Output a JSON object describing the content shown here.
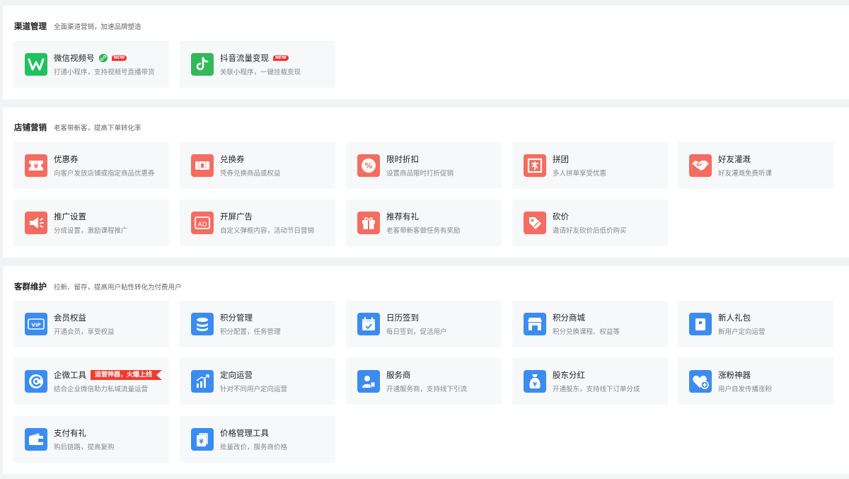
{
  "sections": [
    {
      "title": "渠道管理",
      "subtitle": "全面渠道营销，加速品牌塑造",
      "cards": [
        {
          "title": "微信视频号",
          "desc": "打通小程序，支持视频号直播带货",
          "badge": "NEW",
          "icon": "wechat-channels-icon"
        },
        {
          "title": "抖音流量变现",
          "desc": "关联小程序，一键挂载变现",
          "badge": "NEW",
          "icon": "douyin-icon"
        }
      ]
    },
    {
      "title": "店铺营销",
      "subtitle": "老客带新客，提高下单转化率",
      "cards": [
        {
          "title": "优惠券",
          "desc": "向客户发放店铺或指定商品优惠券",
          "icon": "coupon-icon"
        },
        {
          "title": "兑换券",
          "desc": "凭券兑换商品或权益",
          "icon": "voucher-icon"
        },
        {
          "title": "限时折扣",
          "desc": "设置商品限时打折促销",
          "icon": "discount-icon"
        },
        {
          "title": "拼团",
          "desc": "多人拼单享受优惠",
          "icon": "group-buy-icon"
        },
        {
          "title": "好友灌溉",
          "desc": "好友灌溉免费听课",
          "icon": "handshake-icon"
        },
        {
          "title": "推广设置",
          "desc": "分成设置，激励课程推广",
          "icon": "megaphone-icon"
        },
        {
          "title": "开屏广告",
          "desc": "自定义弹框内容，活动节日营销",
          "icon": "ad-icon"
        },
        {
          "title": "推荐有礼",
          "desc": "老客带新客做任务有奖励",
          "icon": "gift-icon"
        },
        {
          "title": "砍价",
          "desc": "邀请好友砍价后低价购买",
          "icon": "bargain-icon"
        }
      ]
    },
    {
      "title": "客群维护",
      "subtitle": "拉新、留存，提高用户粘性转化为付费用户",
      "cards": [
        {
          "title": "会员权益",
          "desc": "开通会员，享受权益",
          "icon": "vip-icon",
          "icon_text": "VIP"
        },
        {
          "title": "积分管理",
          "desc": "积分配置，任务管理",
          "icon": "coin-stack-icon"
        },
        {
          "title": "日历签到",
          "desc": "每日签到，促活用户",
          "icon": "calendar-icon"
        },
        {
          "title": "积分商城",
          "desc": "积分兑换课程、权益等",
          "icon": "store-icon"
        },
        {
          "title": "新人礼包",
          "desc": "新用户定向运营",
          "icon": "new-gift-icon"
        },
        {
          "title": "企微工具",
          "desc": "结合企业微信助力私域流量运营",
          "icon": "wecom-icon",
          "ribbon": "运营神器，火爆上线"
        },
        {
          "title": "定向运营",
          "desc": "针对不同用户定向运营",
          "icon": "chart-up-icon"
        },
        {
          "title": "服务商",
          "desc": "开通服务商，支持线下引流",
          "icon": "service-provider-icon"
        },
        {
          "title": "股东分红",
          "desc": "开通股东，支持线下订单分成",
          "icon": "money-bag-icon"
        },
        {
          "title": "涨粉神器",
          "desc": "用户自发传播涨粉",
          "icon": "heart-plus-icon"
        },
        {
          "title": "支付有礼",
          "desc": "购后链路，提高复购",
          "icon": "wallet-icon"
        },
        {
          "title": "价格管理工具",
          "desc": "批量改价，服务商价格",
          "icon": "price-tag-icon"
        }
      ]
    }
  ]
}
